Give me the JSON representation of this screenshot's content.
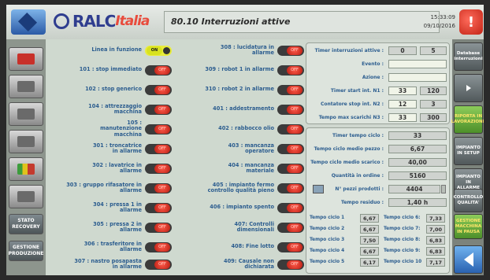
{
  "header": {
    "logo_text": "RALC",
    "logo_suffix": "Italia",
    "title": "80.10 Interruzioni attive",
    "time": "15:33:09",
    "date": "09/10/2016",
    "alarm_label": "!"
  },
  "left_sidebar": {
    "stato_recovery": "STATO RECOVERY",
    "gestione_produzione": "GESTIONE PRODUZIONE"
  },
  "right_sidebar": {
    "database_interruzioni": "Database interruzioni",
    "riporta_in_lavorazione": "RIPORTA IN LAVORAZIONE",
    "impianto_in_setup": "IMPIANTO IN SETUP",
    "impianto_in_allarme": "IMPIANTO IN ALLARME",
    "controllo_qualita": "CONTROLLO QUALITA'",
    "gestione_macchina_pausa": "GESTIONE MACCHINA IN PAUSA"
  },
  "toggle_text": {
    "on": "ON",
    "off": "OFF"
  },
  "interruptions_col1": [
    {
      "label": "Linea in funzione",
      "on": true
    },
    {
      "label": "101 : stop immediato",
      "on": false
    },
    {
      "label": "102 : stop generico",
      "on": false
    },
    {
      "label": "104 : attrezzaggio macchina",
      "on": false
    },
    {
      "label": "105 : manutenzione macchina",
      "on": false
    },
    {
      "label": "301 : troncatrice in allarme",
      "on": false
    },
    {
      "label": "302 : lavatrice in allarme",
      "on": false
    },
    {
      "label": "303 : gruppo rifasatore in allarme",
      "on": false
    },
    {
      "label": "304 : pressa 1 in allarme",
      "on": false
    },
    {
      "label": "305 : pressa 2 in allarme",
      "on": false
    },
    {
      "label": "306 : trasferitore in allarme",
      "on": false
    },
    {
      "label": "307 : nastro posapasta in allarme",
      "on": false
    }
  ],
  "interruptions_col2": [
    {
      "label": "308 : lucidatura in allarme",
      "on": false
    },
    {
      "label": "309 : robot 1 in allarme",
      "on": false
    },
    {
      "label": "310 : robot 2 in allarme",
      "on": false
    },
    {
      "label": "401 : addestramento",
      "on": false
    },
    {
      "label": "402 : rabbocco olio",
      "on": false
    },
    {
      "label": "403 : mancanza operatore",
      "on": false
    },
    {
      "label": "404 : mancanza materiale",
      "on": false
    },
    {
      "label": "405 : impianto fermo controllo qualità pieno",
      "on": false
    },
    {
      "label": "406 : impianto spento",
      "on": false
    },
    {
      "label": "407: Controlli dimensionali",
      "on": false
    },
    {
      "label": "408: Fine lotto",
      "on": false
    },
    {
      "label": "409: Causale non dichiarata",
      "on": false
    }
  ],
  "timer_panel": {
    "timer_interruzioni_attive_label": "Timer interruzioni attive :",
    "timer_interruzioni_attive_a": "0",
    "timer_interruzioni_attive_b": "5",
    "evento_label": "Evento :",
    "evento_value": "",
    "azione_label": "Azione :",
    "azione_value": "",
    "timer_start_label": "Timer start int. N1 :",
    "timer_start_a": "33",
    "timer_start_b": "120",
    "contatore_stop_label": "Contatore stop int. N2 :",
    "contatore_stop_a": "12",
    "contatore_stop_b": "3",
    "tempo_max_label": "Tempo max scarichi N3 :",
    "tempo_max_a": "33",
    "tempo_max_b": "300"
  },
  "production_panel": {
    "timer_tempo_ciclo_label": "Timer tempo ciclo :",
    "timer_tempo_ciclo": "33",
    "tempo_ciclo_medio_pezzo_label": "Tempo ciclo medio pezzo :",
    "tempo_ciclo_medio_pezzo": "6,67",
    "tempo_ciclo_medio_scarico_label": "Tempo ciclo medio scarico :",
    "tempo_ciclo_medio_scarico": "40,00",
    "quantita_ordine_label": "Quantità in ordine :",
    "quantita_ordine": "5160",
    "pezzi_prodotti_label": "N° pezzi prodotti :",
    "pezzi_prodotti": "4404",
    "tempo_residuo_label": "Tempo residuo :",
    "tempo_residuo": "1,40 h"
  },
  "cycle_times": [
    {
      "label": "Tempo ciclo 1",
      "value": "6,67",
      "label2": "Tempo ciclo 6:",
      "value2": "7,33"
    },
    {
      "label": "Tempo ciclo 2",
      "value": "6,67",
      "label2": "Tempo ciclo 7:",
      "value2": "7,00"
    },
    {
      "label": "Tempo ciclo 3",
      "value": "7,50",
      "label2": "Tempo ciclo 8:",
      "value2": "6,83"
    },
    {
      "label": "Tempo ciclo 4",
      "value": "6,67",
      "label2": "Tempo ciclo 9:",
      "value2": "6,83"
    },
    {
      "label": "Tempo ciclo 5",
      "value": "6,17",
      "label2": "Tempo ciclo 10",
      "value2": "7,17"
    }
  ]
}
